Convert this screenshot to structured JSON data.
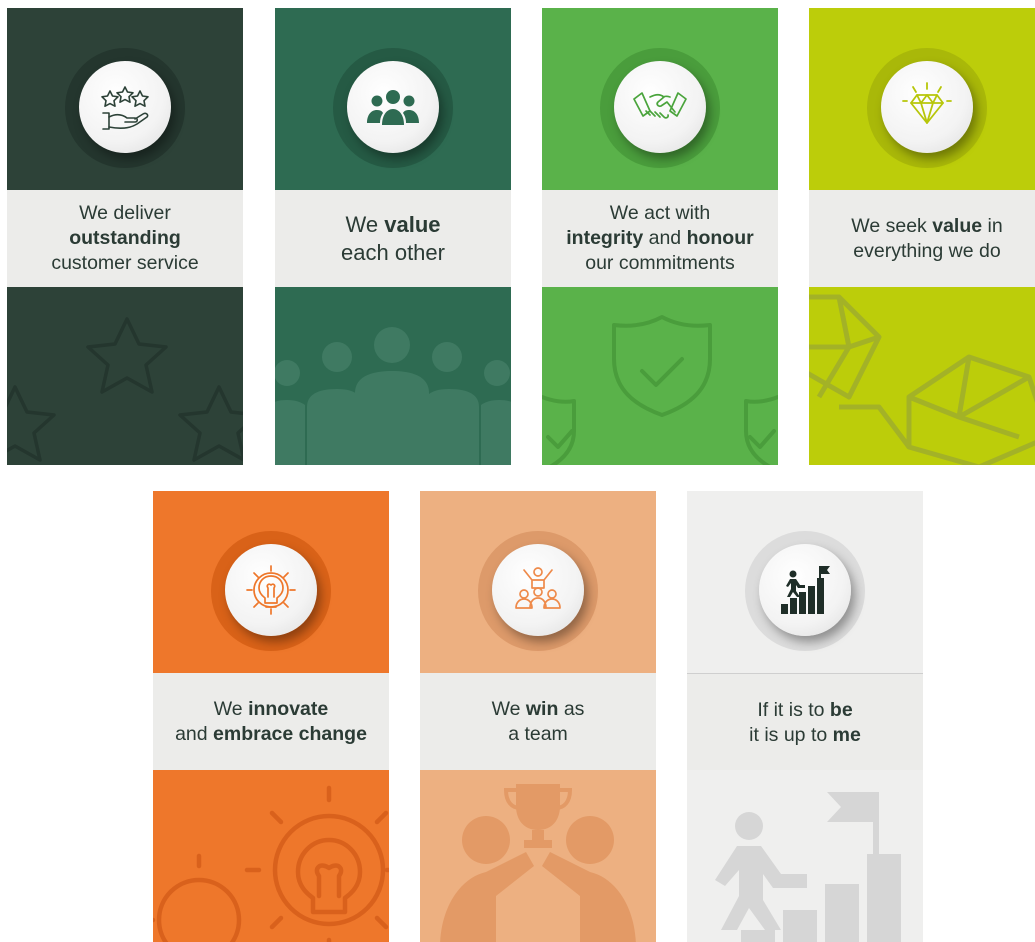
{
  "cards": [
    {
      "pre": "We deliver",
      "bold": "outstanding",
      "post": "customer service",
      "icon": "hand-stars-icon",
      "bg": "stars-pattern",
      "color": "#2d4238"
    },
    {
      "pre": "We",
      "bold": "value",
      "post": "each other",
      "icon": "people-group-icon",
      "bg": "people-pattern",
      "color": "#2e6b52"
    },
    {
      "pre": "We act with",
      "bold": "integrity",
      "mid": "and",
      "bold2": "honour",
      "post": "our commitments",
      "icon": "handshake-icon",
      "bg": "shield-pattern",
      "color": "#5ab24a"
    },
    {
      "pre": "We seek",
      "bold": "value",
      "mid": "in",
      "post": "everything we do",
      "icon": "diamond-icon",
      "bg": "diamond-pattern",
      "color": "#bccd0a"
    },
    {
      "pre": "We",
      "bold": "innovate",
      "mid": "and",
      "bold2": "embrace change",
      "icon": "lightbulb-gear-icon",
      "bg": "gear-bulb-pattern",
      "color": "#ee772b"
    },
    {
      "pre": "We",
      "bold": "win",
      "mid": "as",
      "post": "a team",
      "icon": "team-celebration-icon",
      "bg": "trophy-pattern",
      "color": "#edb081"
    },
    {
      "pre": "If it is to",
      "bold": "be",
      "mid": "it is up to",
      "bold2": "me",
      "icon": "climbing-stairs-icon",
      "bg": "stairs-pattern",
      "color": "#efefee"
    }
  ]
}
